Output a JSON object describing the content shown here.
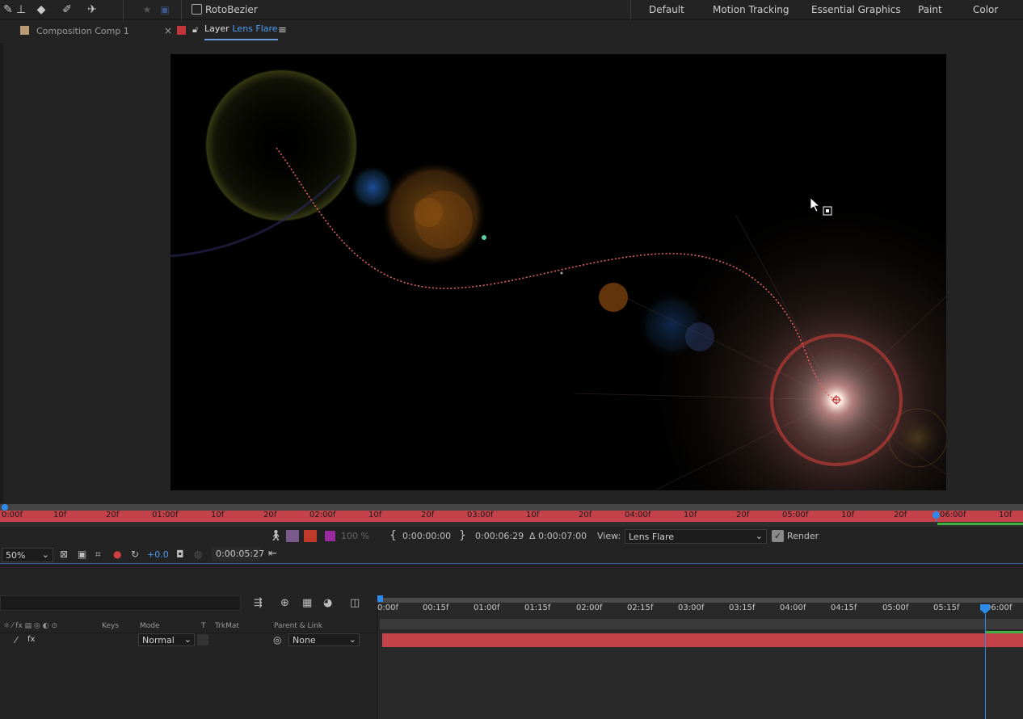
{
  "toolbar": {
    "rotobezier_label": "RotoBezier",
    "workspaces": [
      "Default",
      "Motion Tracking",
      "Essential Graphics",
      "Paint",
      "Color"
    ],
    "icons": [
      "brush-icon",
      "clone-stamp-icon",
      "eraser-icon",
      "roto-brush-icon",
      "puppet-pin-icon"
    ]
  },
  "tabs": {
    "composition_label": "Composition Comp 1",
    "layer_prefix": "Layer",
    "layer_name": "Lens Flare",
    "close_glyph": "×",
    "menu_glyph": "≡"
  },
  "layer_ruler": {
    "labels": [
      "0:00f",
      "10f",
      "20f",
      "01:00f",
      "10f",
      "20f",
      "02:00f",
      "10f",
      "20f",
      "03:00f",
      "10f",
      "20f",
      "04:00f",
      "10f",
      "20f",
      "05:00f",
      "10f",
      "20f",
      "06:00f",
      "10f"
    ]
  },
  "viewer_controls": {
    "opacity_label": "100 %",
    "in_point": "0:00:00:00",
    "out_point": "0:00:06:29",
    "duration": "Δ 0:00:07:00",
    "view_label": "View:",
    "view_value": "Lens Flare",
    "render_label": "Render",
    "zoom_value": "50%",
    "exposure_value": "+0.0",
    "current_time": "0:00:05:27"
  },
  "timeline": {
    "col_keys": "Keys",
    "col_mode": "Mode",
    "col_t": "T",
    "col_trkmat": "TrkMat",
    "col_parent": "Parent & Link",
    "mode_value": "Normal",
    "parent_value": "None",
    "ticks": [
      "0:00f",
      "00:15f",
      "01:00f",
      "01:15f",
      "02:00f",
      "02:15f",
      "03:00f",
      "03:15f",
      "04:00f",
      "04:15f",
      "05:00f",
      "05:15f",
      "06:00f"
    ]
  },
  "colors": {
    "accent": "#2d8ceb",
    "layer_bar": "#c4424a",
    "label_red": "#c0392b",
    "motion_path": "#e06060"
  }
}
